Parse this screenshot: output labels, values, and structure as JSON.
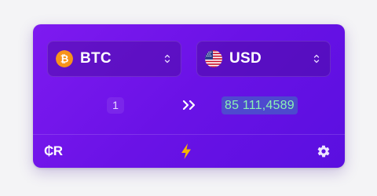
{
  "converter": {
    "from": {
      "code": "BTC",
      "icon": "bitcoin-icon",
      "color": "#f7931a"
    },
    "to": {
      "code": "USD",
      "icon": "us-flag-icon"
    },
    "amount": "1",
    "result": "85 111,4589",
    "arrow_icon": "double-chevron-right-icon"
  },
  "footer": {
    "logo": "₵R",
    "action_icon": "lightning-bolt-icon",
    "settings_icon": "gear-icon"
  },
  "colors": {
    "card_gradient_start": "#7e1af0",
    "card_gradient_end": "#5a0fe0",
    "result_text": "#8bf0b4",
    "bolt": "#f5b400"
  }
}
